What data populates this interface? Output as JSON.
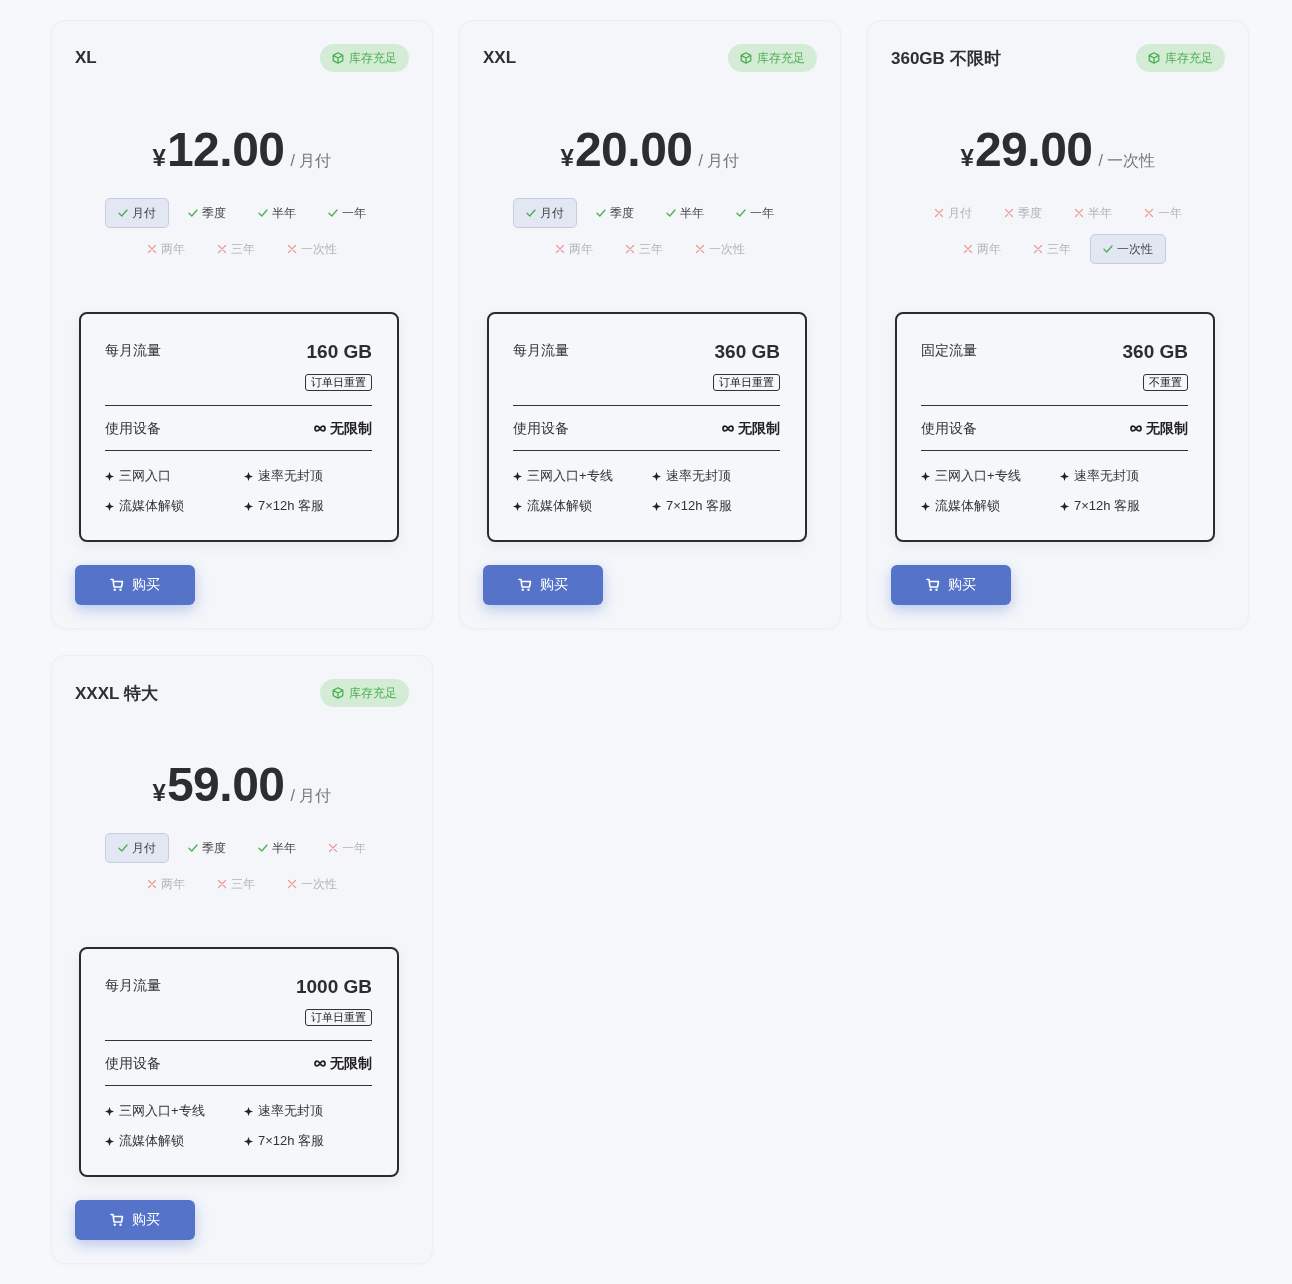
{
  "plans": [
    {
      "name": "XL",
      "stock": "库存充足",
      "currency": "¥",
      "price": "12.00",
      "period": "/ 月付",
      "periods": [
        {
          "label": "月付",
          "available": true,
          "selected": true
        },
        {
          "label": "季度",
          "available": true,
          "selected": false
        },
        {
          "label": "半年",
          "available": true,
          "selected": false
        },
        {
          "label": "一年",
          "available": true,
          "selected": false
        },
        {
          "label": "两年",
          "available": false,
          "selected": false
        },
        {
          "label": "三年",
          "available": false,
          "selected": false
        },
        {
          "label": "一次性",
          "available": false,
          "selected": false
        }
      ],
      "traffic_label": "每月流量",
      "traffic": "160 GB",
      "reset": "订单日重置",
      "devices_label": "使用设备",
      "devices": "无限制",
      "features": [
        "三网入口",
        "速率无封顶",
        "流媒体解锁",
        "7×12h 客服"
      ],
      "buy": "购买"
    },
    {
      "name": "XXL",
      "stock": "库存充足",
      "currency": "¥",
      "price": "20.00",
      "period": "/ 月付",
      "periods": [
        {
          "label": "月付",
          "available": true,
          "selected": true
        },
        {
          "label": "季度",
          "available": true,
          "selected": false
        },
        {
          "label": "半年",
          "available": true,
          "selected": false
        },
        {
          "label": "一年",
          "available": true,
          "selected": false
        },
        {
          "label": "两年",
          "available": false,
          "selected": false
        },
        {
          "label": "三年",
          "available": false,
          "selected": false
        },
        {
          "label": "一次性",
          "available": false,
          "selected": false
        }
      ],
      "traffic_label": "每月流量",
      "traffic": "360 GB",
      "reset": "订单日重置",
      "devices_label": "使用设备",
      "devices": "无限制",
      "features": [
        "三网入口+专线",
        "速率无封顶",
        "流媒体解锁",
        "7×12h 客服"
      ],
      "buy": "购买"
    },
    {
      "name": "360GB 不限时",
      "stock": "库存充足",
      "currency": "¥",
      "price": "29.00",
      "period": "/ 一次性",
      "periods": [
        {
          "label": "月付",
          "available": false,
          "selected": false
        },
        {
          "label": "季度",
          "available": false,
          "selected": false
        },
        {
          "label": "半年",
          "available": false,
          "selected": false
        },
        {
          "label": "一年",
          "available": false,
          "selected": false
        },
        {
          "label": "两年",
          "available": false,
          "selected": false
        },
        {
          "label": "三年",
          "available": false,
          "selected": false
        },
        {
          "label": "一次性",
          "available": true,
          "selected": true
        }
      ],
      "traffic_label": "固定流量",
      "traffic": "360 GB",
      "reset": "不重置",
      "devices_label": "使用设备",
      "devices": "无限制",
      "features": [
        "三网入口+专线",
        "速率无封顶",
        "流媒体解锁",
        "7×12h 客服"
      ],
      "buy": "购买"
    },
    {
      "name": "XXXL 特大",
      "stock": "库存充足",
      "currency": "¥",
      "price": "59.00",
      "period": "/ 月付",
      "periods": [
        {
          "label": "月付",
          "available": true,
          "selected": true
        },
        {
          "label": "季度",
          "available": true,
          "selected": false
        },
        {
          "label": "半年",
          "available": true,
          "selected": false
        },
        {
          "label": "一年",
          "available": false,
          "selected": false
        },
        {
          "label": "两年",
          "available": false,
          "selected": false
        },
        {
          "label": "三年",
          "available": false,
          "selected": false
        },
        {
          "label": "一次性",
          "available": false,
          "selected": false
        }
      ],
      "traffic_label": "每月流量",
      "traffic": "1000 GB",
      "reset": "订单日重置",
      "devices_label": "使用设备",
      "devices": "无限制",
      "features": [
        "三网入口+专线",
        "速率无封顶",
        "流媒体解锁",
        "7×12h 客服"
      ],
      "buy": "购买"
    }
  ]
}
